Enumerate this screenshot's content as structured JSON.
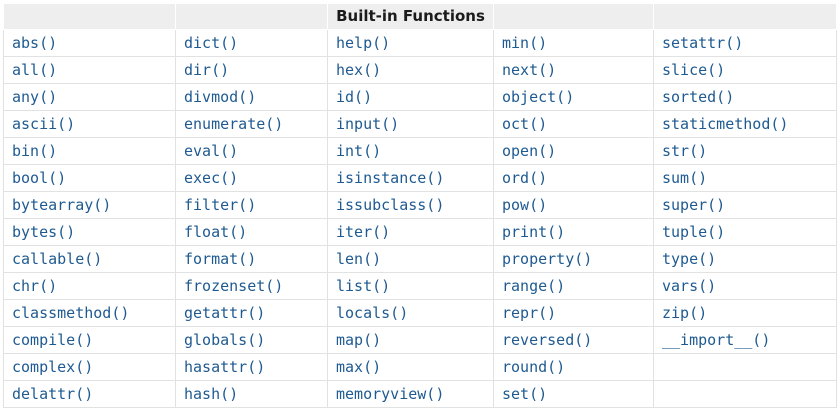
{
  "table": {
    "title": "Built-in Functions",
    "header_cells": [
      "",
      "",
      "Built-in Functions",
      "",
      ""
    ],
    "rows": [
      [
        "abs()",
        "dict()",
        "help()",
        "min()",
        "setattr()"
      ],
      [
        "all()",
        "dir()",
        "hex()",
        "next()",
        "slice()"
      ],
      [
        "any()",
        "divmod()",
        "id()",
        "object()",
        "sorted()"
      ],
      [
        "ascii()",
        "enumerate()",
        "input()",
        "oct()",
        "staticmethod()"
      ],
      [
        "bin()",
        "eval()",
        "int()",
        "open()",
        "str()"
      ],
      [
        "bool()",
        "exec()",
        "isinstance()",
        "ord()",
        "sum()"
      ],
      [
        "bytearray()",
        "filter()",
        "issubclass()",
        "pow()",
        "super()"
      ],
      [
        "bytes()",
        "float()",
        "iter()",
        "print()",
        "tuple()"
      ],
      [
        "callable()",
        "format()",
        "len()",
        "property()",
        "type()"
      ],
      [
        "chr()",
        "frozenset()",
        "list()",
        "range()",
        "vars()"
      ],
      [
        "classmethod()",
        "getattr()",
        "locals()",
        "repr()",
        "zip()"
      ],
      [
        "compile()",
        "globals()",
        "map()",
        "reversed()",
        "__import__()"
      ],
      [
        "complex()",
        "hasattr()",
        "max()",
        "round()",
        ""
      ],
      [
        "delattr()",
        "hash()",
        "memoryview()",
        "set()",
        ""
      ]
    ]
  },
  "colors": {
    "link": "#1e5a91",
    "header_bg": "#eeeeee",
    "border": "#e2e2e2",
    "header_text": "#1b1b1b"
  }
}
